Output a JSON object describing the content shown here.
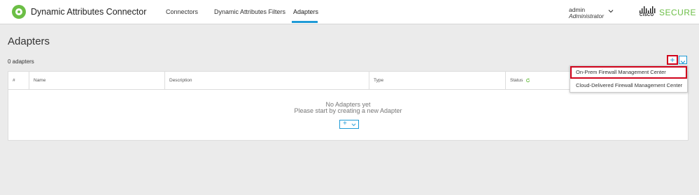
{
  "header": {
    "app_title": "Dynamic Attributes Connector",
    "nav": [
      {
        "label": "Connectors",
        "active": false
      },
      {
        "label": "Dynamic Attributes Filters",
        "active": false
      },
      {
        "label": "Adapters",
        "active": true
      }
    ],
    "user": {
      "name": "admin",
      "role": "Administrator"
    },
    "brand": {
      "cisco": "CISCO",
      "secure": "SECURE"
    }
  },
  "page": {
    "title": "Adapters",
    "count_label": "0 adapters"
  },
  "table": {
    "columns": [
      "#",
      "Name",
      "Description",
      "Type",
      "Status"
    ],
    "empty_title": "No Adapters yet",
    "empty_subtitle": "Please start by creating a new Adapter",
    "add_plus": "+"
  },
  "add_menu": {
    "plus": "+",
    "items": [
      {
        "label": "On-Prem Firewall Management Center",
        "highlighted": true
      },
      {
        "label": "Cloud-Delivered Firewall Management Center",
        "highlighted": false
      }
    ]
  },
  "colors": {
    "accent": "#1e9ad6",
    "brand_green": "#6bbe45",
    "highlight_red": "#d0021b",
    "background": "#ebebeb"
  },
  "icons": [
    "app-logo-icon",
    "chevron-down-icon",
    "cisco-logo-icon",
    "plus-icon",
    "refresh-icon"
  ]
}
